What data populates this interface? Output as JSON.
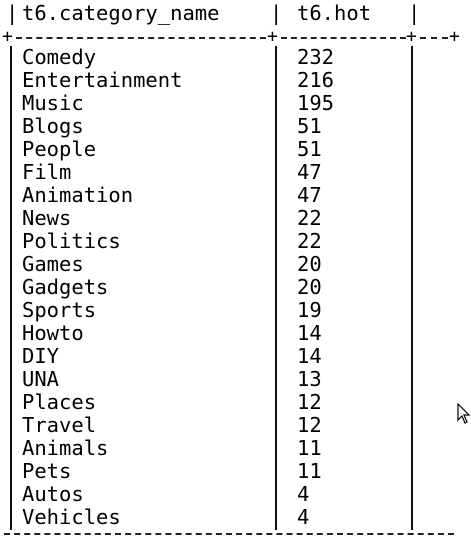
{
  "table": {
    "columns": [
      "t6.category_name",
      "t6.hot"
    ],
    "rows": [
      {
        "category_name": "Comedy",
        "hot": "232"
      },
      {
        "category_name": "Entertainment",
        "hot": "216"
      },
      {
        "category_name": "Music",
        "hot": "195"
      },
      {
        "category_name": "Blogs",
        "hot": "51"
      },
      {
        "category_name": "People",
        "hot": "51"
      },
      {
        "category_name": "Film",
        "hot": "47"
      },
      {
        "category_name": "Animation",
        "hot": "47"
      },
      {
        "category_name": "News",
        "hot": "22"
      },
      {
        "category_name": "Politics",
        "hot": "22"
      },
      {
        "category_name": "Games",
        "hot": "20"
      },
      {
        "category_name": "Gadgets",
        "hot": "20"
      },
      {
        "category_name": "Sports",
        "hot": "19"
      },
      {
        "category_name": "Howto",
        "hot": "14"
      },
      {
        "category_name": "DIY",
        "hot": "14"
      },
      {
        "category_name": "UNA",
        "hot": "13"
      },
      {
        "category_name": "Places",
        "hot": "12"
      },
      {
        "category_name": "Travel",
        "hot": "12"
      },
      {
        "category_name": "Animals",
        "hot": "11"
      },
      {
        "category_name": "Pets",
        "hot": "11"
      },
      {
        "category_name": "Autos",
        "hot": "4"
      },
      {
        "category_name": "Vehicles",
        "hot": "4"
      }
    ]
  },
  "colors": {
    "background": "#ffffff",
    "text": "#000000"
  },
  "icons": {
    "cursor": "mouse-pointer-icon"
  }
}
